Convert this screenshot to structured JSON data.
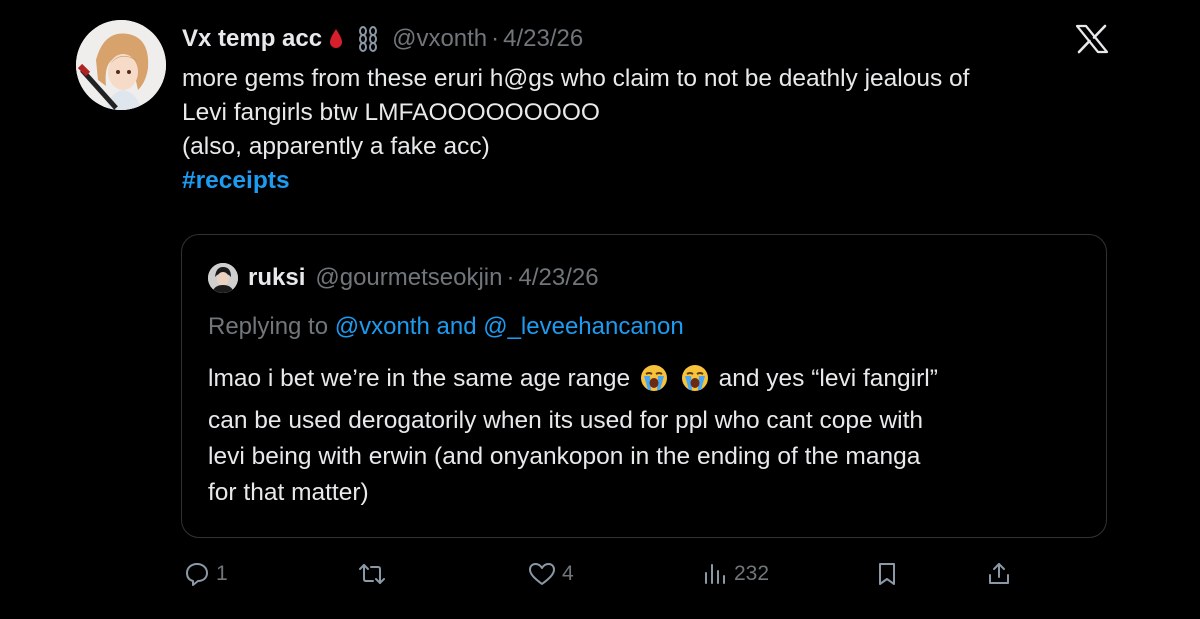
{
  "post": {
    "display_name": "Vx temp acc",
    "name_emoji": [
      "drop-of-blood-emoji",
      "chains-emoji"
    ],
    "handle": "@vxonth",
    "separator": "·",
    "date": "4/23/26",
    "text_lines": [
      "more gems from these eruri h@gs who claim to not be deathly jealous of",
      "Levi fangirls btw LMFAOOOOOOOOO",
      "(also, apparently a fake acc)"
    ],
    "hashtag": "#receipts"
  },
  "quoted": {
    "display_name": "ruksi",
    "handle": "@gourmetseokjin",
    "separator": "·",
    "date": "4/23/26",
    "replying_prefix": "Replying to",
    "replying_mentions": "@vxonth and @_leveehancanon",
    "line1_before": "lmao i bet we’re in the same age range",
    "line1_after": "and yes “levi fangirl”",
    "text_lines": [
      "can be used derogatorily when its used for ppl who cant cope with",
      "levi being with erwin (and onyankopon in the ending of the manga",
      "for that matter)"
    ]
  },
  "actions": {
    "replies": "1",
    "reposts": "",
    "likes": "4",
    "views": "232"
  },
  "colors": {
    "background": "#000000",
    "text": "#e7e9ea",
    "muted": "#71767b",
    "accent": "#1d9bf0",
    "border": "#2f3336"
  }
}
